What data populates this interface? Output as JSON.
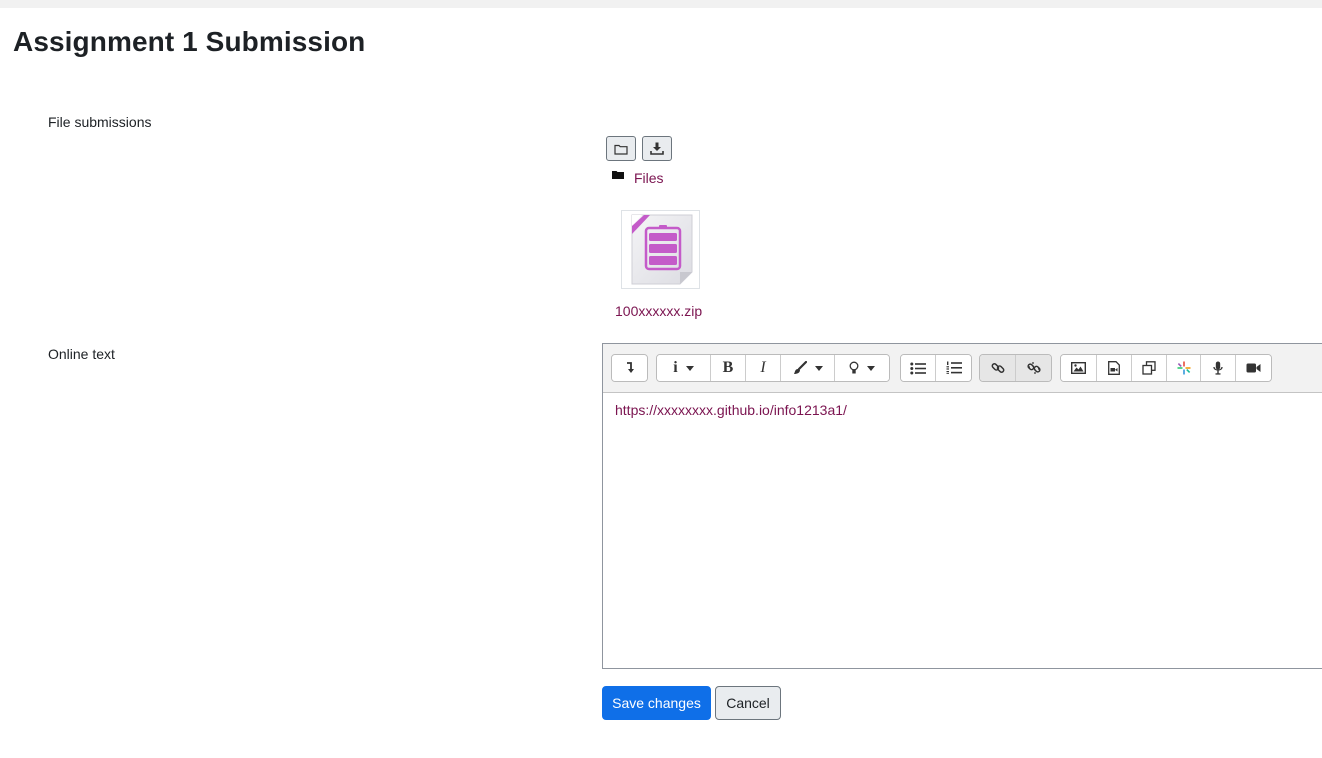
{
  "page": {
    "title": "Assignment 1 Submission"
  },
  "file_submissions": {
    "label": "File submissions",
    "breadcrumb": "Files",
    "files": [
      {
        "name": "100xxxxxx.zip",
        "icon": "archive-zip-icon"
      }
    ],
    "toolbar_icons": [
      "folder-create-icon",
      "download-all-icon"
    ]
  },
  "online_text": {
    "label": "Online text",
    "content": "https://xxxxxxxx.github.io/info1213a1/",
    "toolbar": {
      "icons": [
        "collapse-icon",
        "info-style-icon",
        "bold-icon",
        "italic-icon",
        "text-color-icon",
        "highlight-icon",
        "unordered-list-icon",
        "ordered-list-icon",
        "link-icon",
        "unlink-icon",
        "image-icon",
        "media-icon",
        "manage-files-icon",
        "h5p-icon",
        "record-audio-icon",
        "record-video-icon"
      ],
      "bold_glyph": "B",
      "italic_glyph": "I",
      "info_glyph": "i"
    }
  },
  "actions": {
    "save_label": "Save changes",
    "cancel_label": "Cancel"
  },
  "colors": {
    "link": "#7b1450",
    "primary_button": "#0f6fe8",
    "zip_icon": "#c45bc9"
  }
}
